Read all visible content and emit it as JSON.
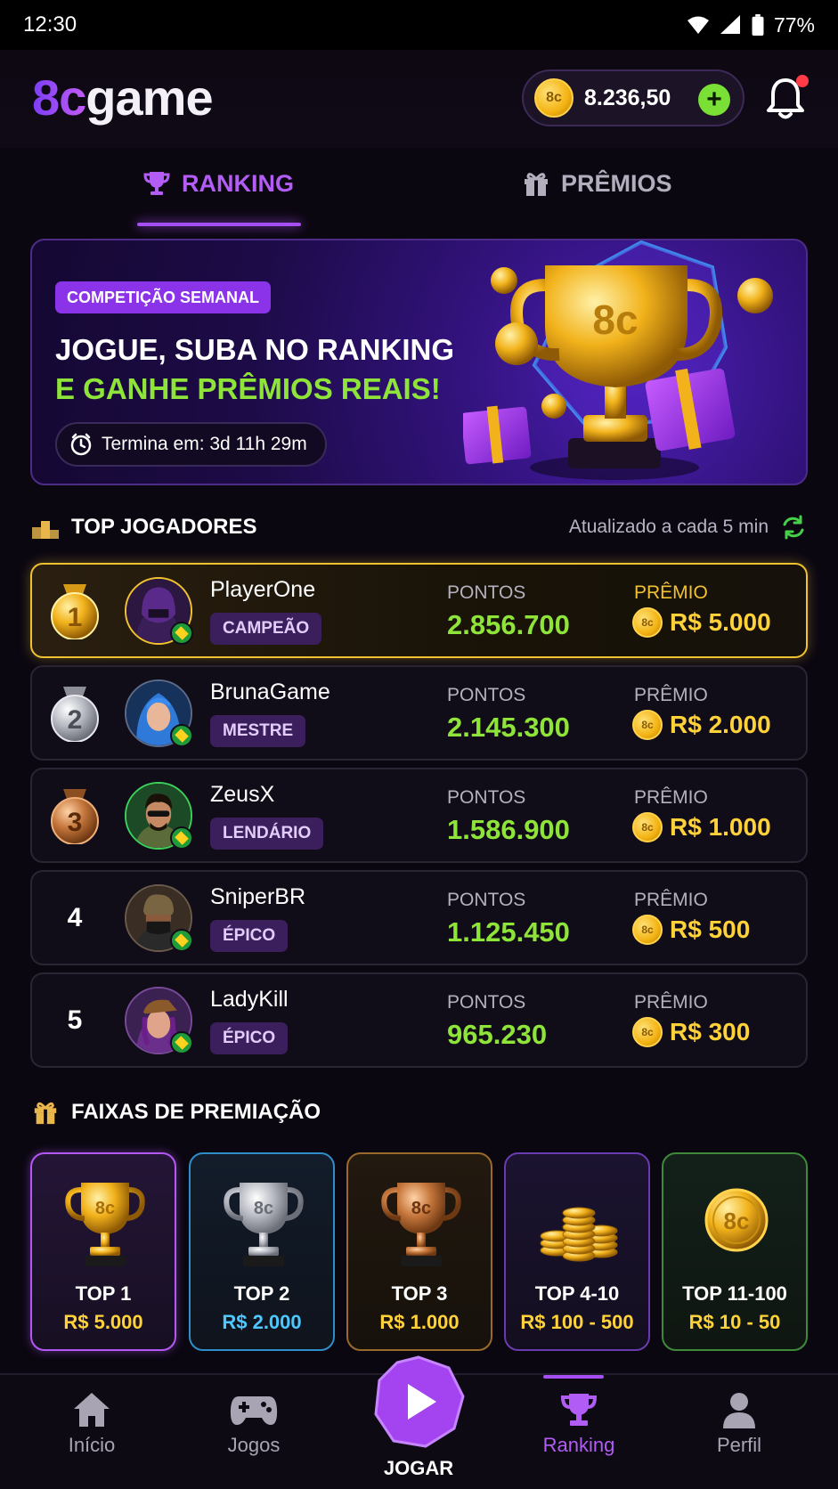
{
  "status_bar": {
    "time": "12:30",
    "battery": "77%"
  },
  "header": {
    "logo_part1": "8c",
    "logo_part2": "game",
    "balance": "8.236,50",
    "coin_label": "8c",
    "add_label": "+"
  },
  "tabs": [
    {
      "label": "RANKING",
      "icon": "trophy-icon",
      "active": true
    },
    {
      "label": "PRÊMIOS",
      "icon": "gift-icon",
      "active": false
    }
  ],
  "banner": {
    "badge": "COMPETIÇÃO SEMANAL",
    "line1": "JOGUE, SUBA NO RANKING",
    "line2": "E GANHE PRÊMIOS REAIS!",
    "timer": "Termina em: 3d 11h 29m",
    "trophy_label": "8c"
  },
  "top_players": {
    "title": "TOP JOGADORES",
    "updated": "Atualizado a cada 5 min",
    "points_label": "PONTOS",
    "prize_label": "PRÊMIO",
    "players": [
      {
        "rank": "1",
        "name": "PlayerOne",
        "tier": "CAMPEÃO",
        "points": "2.856.700",
        "prize": "R$ 5.000",
        "medal": "gold"
      },
      {
        "rank": "2",
        "name": "BrunaGame",
        "tier": "MESTRE",
        "points": "2.145.300",
        "prize": "R$ 2.000",
        "medal": "silver"
      },
      {
        "rank": "3",
        "name": "ZeusX",
        "tier": "LENDÁRIO",
        "points": "1.586.900",
        "prize": "R$ 1.000",
        "medal": "bronze"
      },
      {
        "rank": "4",
        "name": "SniperBR",
        "tier": "ÉPICO",
        "points": "1.125.450",
        "prize": "R$ 500",
        "medal": "none"
      },
      {
        "rank": "5",
        "name": "LadyKill",
        "tier": "ÉPICO",
        "points": "965.230",
        "prize": "R$ 300",
        "medal": "none"
      }
    ]
  },
  "prize_tiers": {
    "title": "FAIXAS DE PREMIAÇÃO",
    "tiers": [
      {
        "label": "TOP 1",
        "value": "R$ 5.000",
        "color": "#b458f5",
        "value_color": "#ffd23a"
      },
      {
        "label": "TOP 2",
        "value": "R$ 2.000",
        "color": "#2f8ec9",
        "value_color": "#4dc8ff"
      },
      {
        "label": "TOP 3",
        "value": "R$ 1.000",
        "color": "#9a6a2c",
        "value_color": "#ffd23a"
      },
      {
        "label": "TOP 4-10",
        "value": "R$ 100 - 500",
        "color": "#6a3ab0",
        "value_color": "#ffd23a"
      },
      {
        "label": "TOP 11-100",
        "value": "R$ 10 - 50",
        "color": "#3f8a3a",
        "value_color": "#ffd23a"
      }
    ]
  },
  "bottom_nav": [
    {
      "label": "Início",
      "icon": "home-icon"
    },
    {
      "label": "Jogos",
      "icon": "gamepad-icon"
    },
    {
      "label": "JOGAR",
      "icon": "play-icon"
    },
    {
      "label": "Ranking",
      "icon": "trophy-icon",
      "active": true
    },
    {
      "label": "Perfil",
      "icon": "profile-icon"
    }
  ]
}
